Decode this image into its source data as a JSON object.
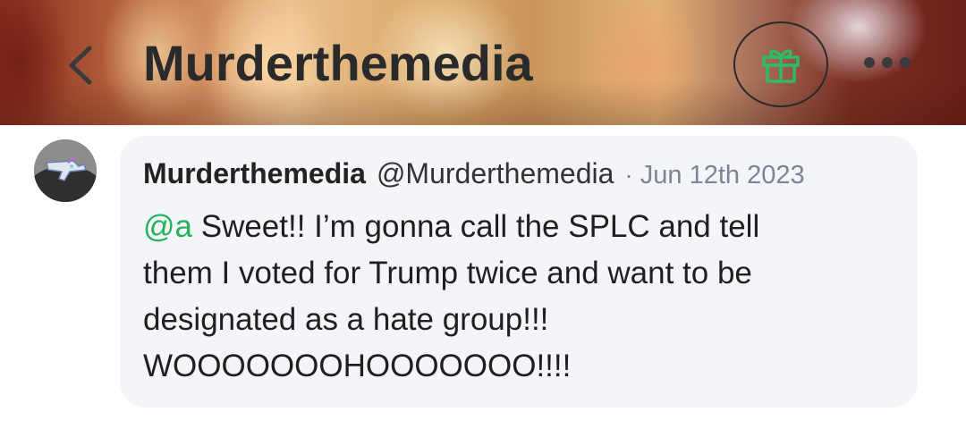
{
  "header": {
    "title": "Murderthemedia",
    "back_icon": "chevron-left-icon",
    "gift_icon": "gift-icon",
    "more_icon": "more-horizontal-icon",
    "accent_color": "#2fba68"
  },
  "post": {
    "author": "Murderthemedia",
    "handle": "@Murderthemedia",
    "separator": "·",
    "date": "Jun 12th 2023",
    "mention": "@a",
    "text_line1": " Sweet!! I’m gonna call the SPLC and tell",
    "text_line2": "them I voted for Trump twice and want to be",
    "text_line3": "designated as a hate group!!!",
    "text_line4": "WOOOOOOOHOOOOOOO!!!!"
  }
}
